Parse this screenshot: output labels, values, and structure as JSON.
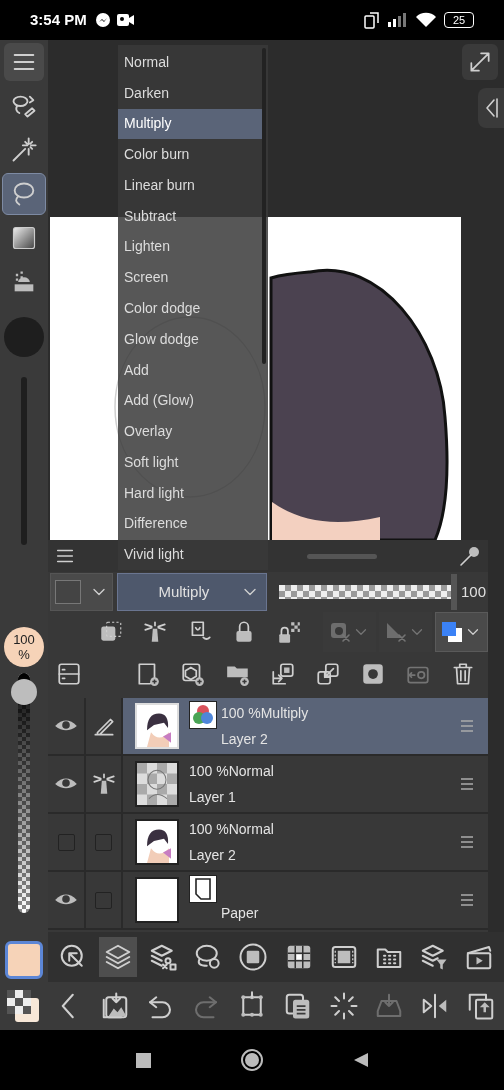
{
  "status_bar": {
    "time": "3:54 PM",
    "battery": "25"
  },
  "tool_palette": [
    {
      "selected": false
    },
    {
      "selected": false
    },
    {
      "selected": false
    },
    {
      "selected": true
    },
    {
      "selected": false
    },
    {
      "selected": false
    }
  ],
  "brush_size": {
    "reading": "100 %",
    "level": 0.97
  },
  "blend_menu": {
    "items": [
      {
        "label": "Normal",
        "selected": false
      },
      {
        "label": "Darken",
        "selected": false
      },
      {
        "label": "Multiply",
        "selected": true
      },
      {
        "label": "Color burn",
        "selected": false
      },
      {
        "label": "Linear burn",
        "selected": false
      },
      {
        "label": "Subtract",
        "selected": false
      },
      {
        "label": "Lighten",
        "selected": false
      },
      {
        "label": "Screen",
        "selected": false
      },
      {
        "label": "Color dodge",
        "selected": false
      },
      {
        "label": "Glow dodge",
        "selected": false
      },
      {
        "label": "Add",
        "selected": false
      },
      {
        "label": "Add (Glow)",
        "selected": false
      },
      {
        "label": "Overlay",
        "selected": false
      },
      {
        "label": "Soft light",
        "selected": false
      },
      {
        "label": "Hard light",
        "selected": false
      },
      {
        "label": "Difference",
        "selected": false
      },
      {
        "label": "Vivid light",
        "selected": false
      }
    ]
  },
  "layer_panel": {
    "blend_mode": "Multiply",
    "opacity": {
      "reading": "100",
      "level": 1
    },
    "layer_tools": [
      {
        "disabled": false
      },
      {
        "disabled": false
      },
      {
        "disabled": false
      },
      {
        "disabled": false
      },
      {
        "disabled": false
      },
      {
        "disabled": true
      },
      {
        "disabled": true
      },
      {
        "disabled": false
      }
    ],
    "layer_actions": [
      {
        "disabled": false
      },
      {
        "disabled": false
      },
      {
        "disabled": false
      },
      {
        "disabled": false
      },
      {
        "disabled": false
      },
      {
        "disabled": false
      },
      {
        "disabled": false
      },
      {
        "disabled": true
      },
      {
        "disabled": false
      }
    ],
    "layers": [
      {
        "kind": "color",
        "mode": "100 %Multiply",
        "name": "Layer 2",
        "visible": true,
        "selected": true,
        "editing": true,
        "reference": false
      },
      {
        "kind": "raster",
        "mode": "100 %Normal",
        "name": "Layer 1",
        "visible": true,
        "selected": false,
        "editing": false,
        "reference": true
      },
      {
        "kind": "raster",
        "mode": "100 %Normal",
        "name": "Layer 2",
        "visible": false,
        "selected": false,
        "editing": false,
        "reference": false
      },
      {
        "kind": "paper",
        "name": "Paper",
        "visible": true,
        "selected": false,
        "editing": false,
        "reference": false
      }
    ]
  },
  "bottom_toolbar": [
    {
      "selected": false
    },
    {
      "selected": true
    },
    {
      "selected": false
    },
    {
      "selected": false
    },
    {
      "selected": false
    },
    {
      "selected": false
    },
    {
      "selected": false
    },
    {
      "selected": false
    },
    {
      "selected": false
    },
    {
      "selected": false
    }
  ],
  "action_bar": [
    {
      "disabled": false
    },
    {
      "disabled": false
    },
    {
      "disabled": false
    },
    {
      "disabled": true
    },
    {
      "disabled": false
    },
    {
      "disabled": false
    },
    {
      "disabled": false
    },
    {
      "disabled": true
    },
    {
      "disabled": false
    },
    {
      "disabled": false
    }
  ]
}
